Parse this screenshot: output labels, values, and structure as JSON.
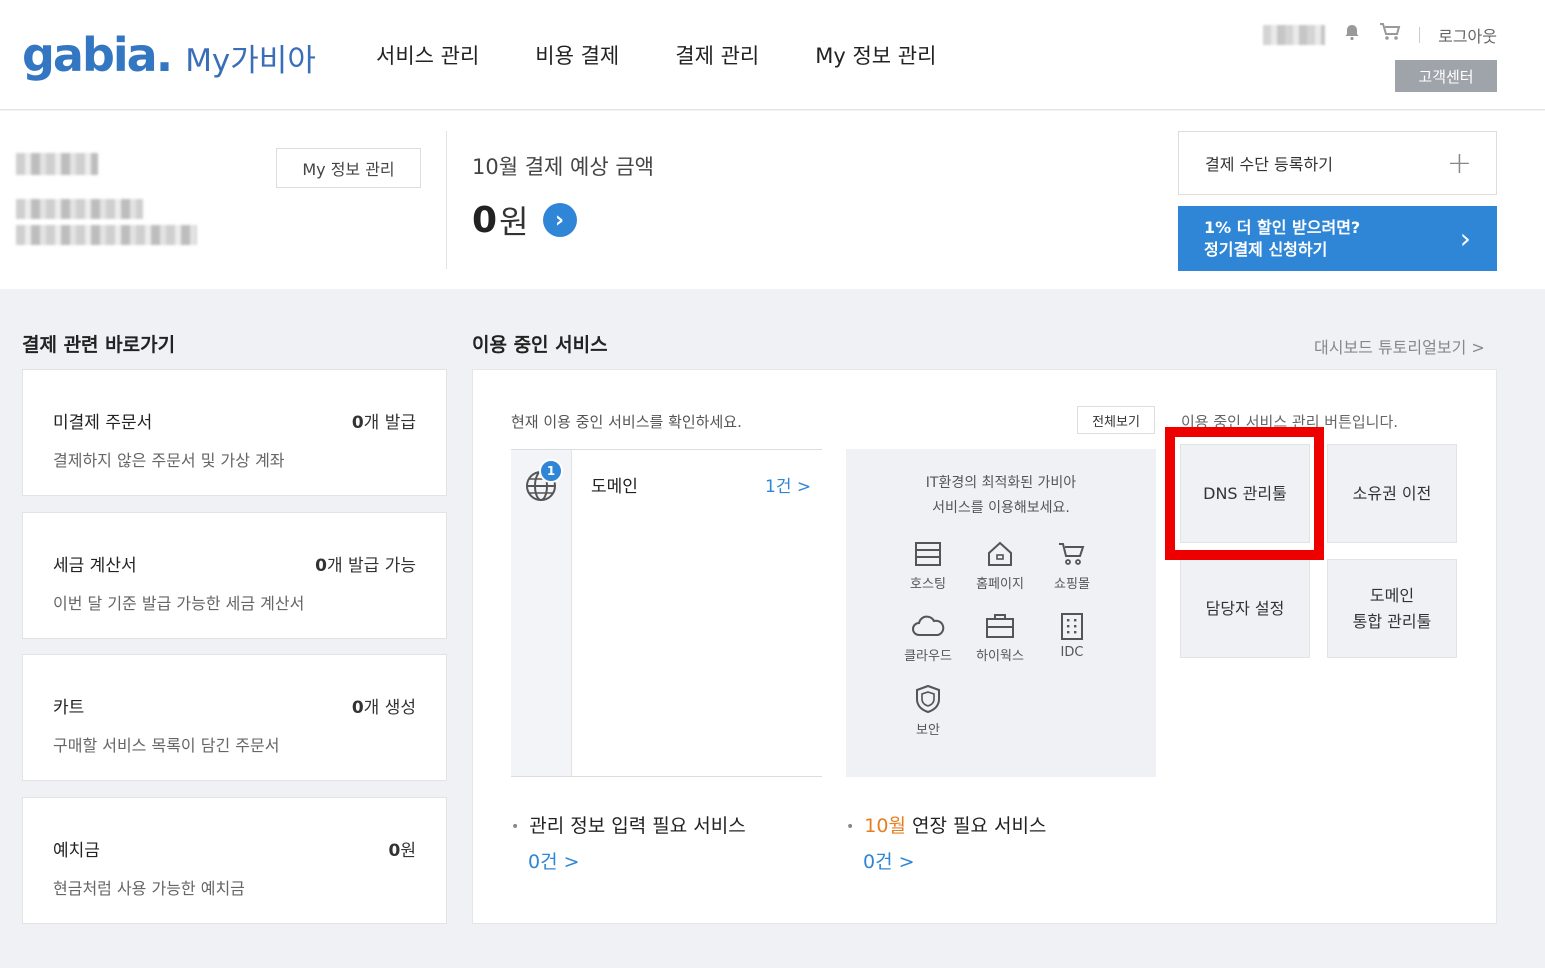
{
  "header": {
    "logo": "gabia.",
    "logo_sub": "My가비아",
    "nav": [
      "서비스 관리",
      "비용 결제",
      "결제 관리",
      "My 정보 관리"
    ],
    "logout": "로그아웃",
    "customer_center": "고객센터"
  },
  "summary": {
    "myinfo_button": "My 정보 관리",
    "pay_title": "10월 결제 예상 금액",
    "pay_amount": "0",
    "pay_unit": "원",
    "pay_method": "결제 수단 등록하기",
    "promo_line1": "1% 더 할인 받으려면?",
    "promo_line2": "정기결제 신청하기"
  },
  "shortcuts": {
    "title": "결제 관련 바로가기",
    "cards": [
      {
        "label": "미결제 주문서",
        "num": "0",
        "suffix": "개 발급",
        "desc": "결제하지 않은 주문서 및 가상 계좌"
      },
      {
        "label": "세금 계산서",
        "num": "0",
        "suffix": "개 발급 가능",
        "desc": "이번 달 기준 발급 가능한 세금 계산서"
      },
      {
        "label": "카트",
        "num": "0",
        "suffix": "개 생성",
        "desc": "구매할 서비스 목록이 담긴 주문서"
      },
      {
        "label": "예치금",
        "num": "0",
        "suffix": "원",
        "desc": "현금처럼 사용 가능한 예치금"
      }
    ]
  },
  "services": {
    "title": "이용 중인 서비스",
    "tutorial": "대시보드 튜토리얼보기 >",
    "hint": "현재 이용 중인 서비스를 확인하세요.",
    "view_all": "전체보기",
    "manage_hint": "이용 중인 서비스 관리 버튼입니다.",
    "list": [
      {
        "name": "도메인",
        "count": "1건 >",
        "badge": "1"
      }
    ],
    "reco_line1": "IT환경의 최적화된 가비아",
    "reco_line2": "서비스를 이용해보세요.",
    "reco_items": [
      "호스팅",
      "홈페이지",
      "쇼핑몰",
      "클라우드",
      "하이웍스",
      "IDC",
      "보안"
    ],
    "manage_buttons": [
      "DNS 관리툴",
      "소유권 이전",
      "담당자 설정",
      "도메인",
      "통합 관리툴"
    ],
    "info_needed_label": "관리 정보 입력 필요 서비스",
    "info_needed_count": "0건 >",
    "renew_month": "10월",
    "renew_label": " 연장 필요 서비스",
    "renew_count": "0건 >"
  },
  "colors": {
    "accent": "#2f86d6",
    "highlight": "#ef0000",
    "orange": "#e67e22"
  }
}
